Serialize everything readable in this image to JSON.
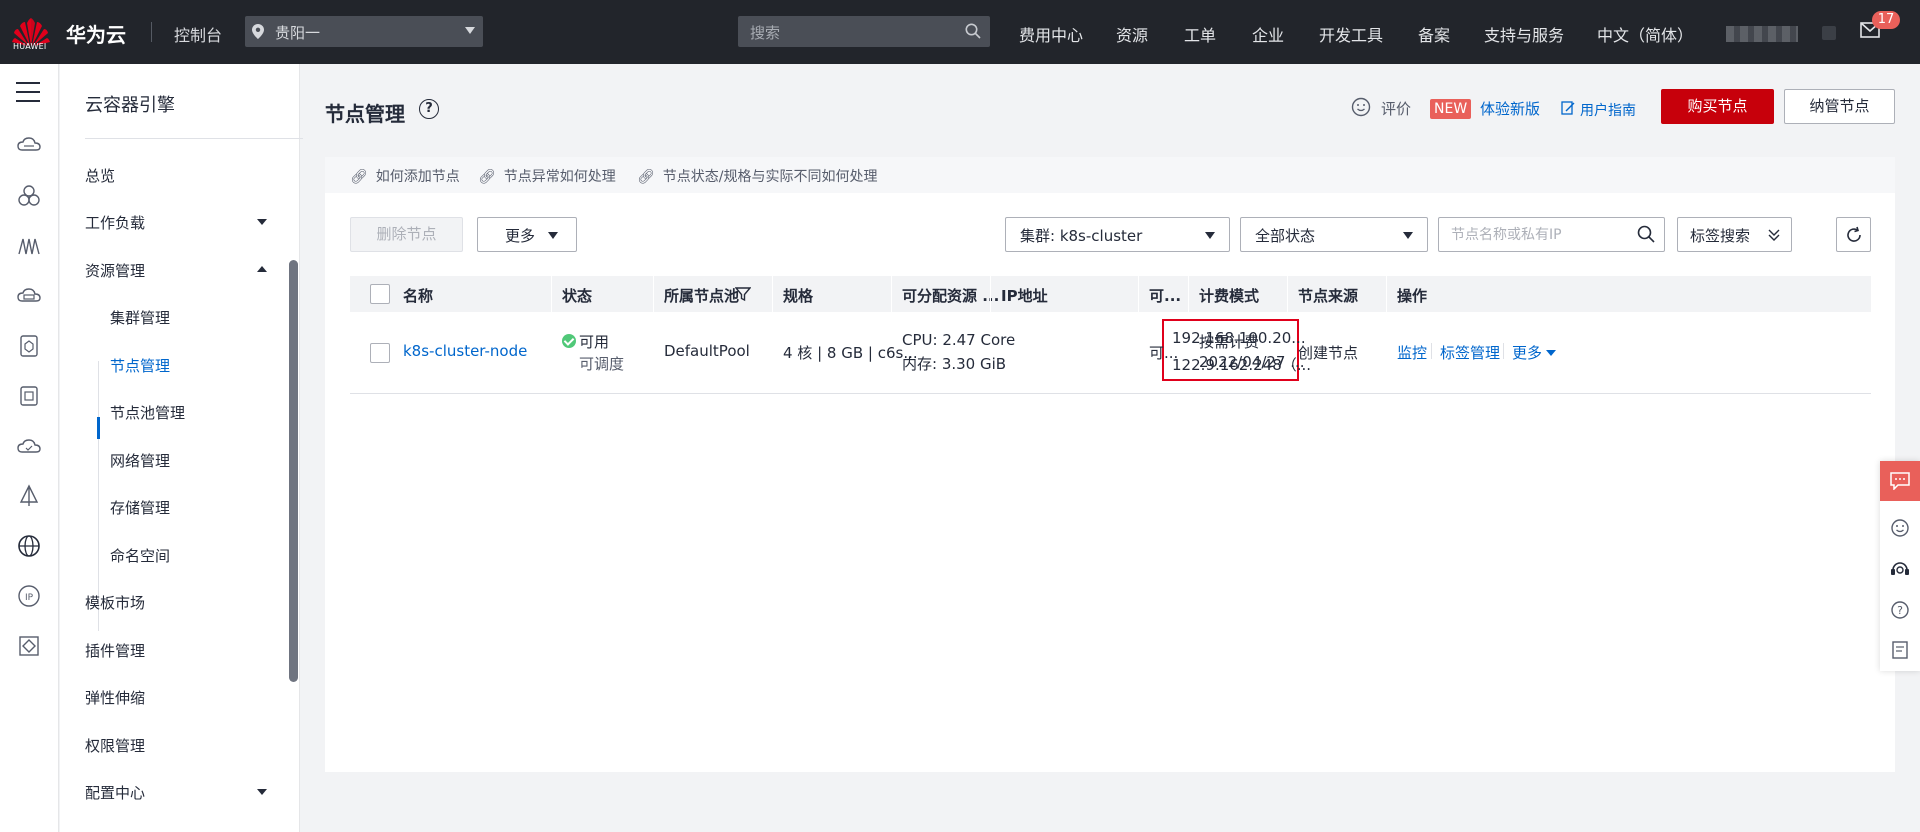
{
  "topbar": {
    "logo_text": "HUAWEI",
    "brand": "华为云",
    "console": "控制台",
    "region": "贵阳一",
    "search_placeholder": "搜索",
    "nav": [
      "费用中心",
      "资源",
      "工单",
      "企业",
      "开发工具",
      "备案",
      "支持与服务",
      "中文（简体）"
    ],
    "mail_badge": "17"
  },
  "rail_icons": [
    "menu-icon",
    "cloud-server-icon",
    "cluster-icon",
    "network-icon",
    "storage-icon",
    "container-icon",
    "image-icon",
    "cloud-icon",
    "deploy-icon",
    "globe-icon",
    "ip-icon",
    "diamond-icon"
  ],
  "sidebar": {
    "title": "云容器引擎",
    "items": {
      "overview": "总览",
      "workloads": "工作负载",
      "resources": "资源管理",
      "cluster": "集群管理",
      "node": "节点管理",
      "nodepool": "节点池管理",
      "network": "网络管理",
      "storage": "存储管理",
      "namespace": "命名空间",
      "templates": "模板市场",
      "addons": "插件管理",
      "scaling": "弹性伸缩",
      "permissions": "权限管理",
      "config": "配置中心"
    }
  },
  "header": {
    "title": "节点管理",
    "rate": "评价",
    "new_tag": "NEW",
    "try_new": "体验新版",
    "guide": "用户指南",
    "buy_node": "购买节点",
    "manage_node": "纳管节点"
  },
  "tips": [
    "如何添加节点",
    "节点异常如何处理",
    "节点状态/规格与实际不同如何处理"
  ],
  "toolbar": {
    "delete": "删除节点",
    "more": "更多",
    "cluster_select": "集群:  k8s-cluster",
    "status_select": "全部状态",
    "search_placeholder": "节点名称或私有IP",
    "tag_search": "标签搜索"
  },
  "table": {
    "headers": [
      "名称",
      "状态",
      "所属节点池",
      "规格",
      "可分配资源 ...",
      "IP地址",
      "可...",
      "计费模式",
      "节点来源",
      "操作"
    ],
    "rows": [
      {
        "name": "k8s-cluster-node",
        "status": "可用",
        "status_sub": "可调度",
        "pool": "DefaultPool",
        "spec": "4 核 | 8 GB | c6s...",
        "cpu": "CPU: 2.47 Core",
        "mem": "内存: 3.30 GiB",
        "ip1": "192.168.100.20...",
        "ip2": "122.9.162.248（...",
        "az": "可...",
        "billing": "按需计费",
        "billing_date": "2022/04/27 ...",
        "source": "创建节点",
        "ops": [
          "监控",
          "标签管理",
          "更多"
        ]
      }
    ]
  },
  "colors": {
    "topbar": "#22252b",
    "primary_red": "#c7000b",
    "link": "#0066cc",
    "highlight_box": "#e0001b",
    "status_ok": "#50c878",
    "badge": "#e9605a"
  }
}
